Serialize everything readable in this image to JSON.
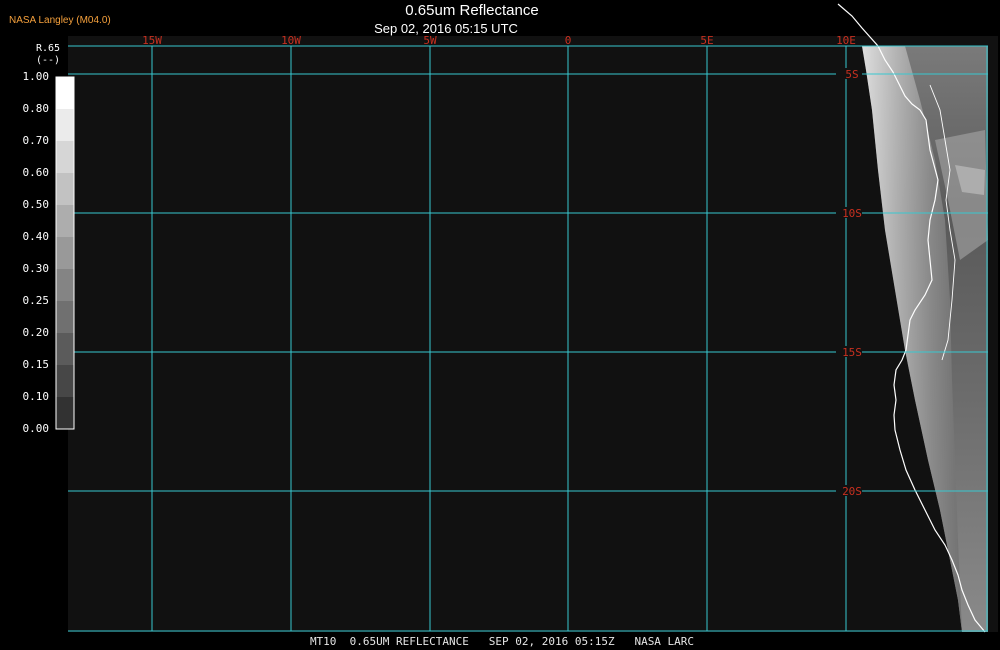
{
  "header": {
    "credit": "NASA Langley (M04.0)",
    "title": "0.65um Reflectance",
    "subtitle": "Sep 02, 2016 05:15 UTC"
  },
  "footer": {
    "caption": "MT10  0.65UM REFLECTANCE   SEP 02, 2016 05:15Z   NASA LARC"
  },
  "legend": {
    "variable": "R.65",
    "units": "(--)",
    "ticks": [
      "1.00",
      "0.80",
      "0.70",
      "0.60",
      "0.50",
      "0.40",
      "0.30",
      "0.25",
      "0.20",
      "0.15",
      "0.10",
      "0.00"
    ]
  },
  "map": {
    "longitude_labels": [
      "15W",
      "10W",
      "5W",
      "0",
      "5E",
      "10E"
    ],
    "latitude_labels": [
      "5S",
      "10S",
      "15S",
      "20S"
    ],
    "grid_color": "#38c8d0",
    "label_color": "#c83020",
    "coastline_color": "#ffffff"
  }
}
